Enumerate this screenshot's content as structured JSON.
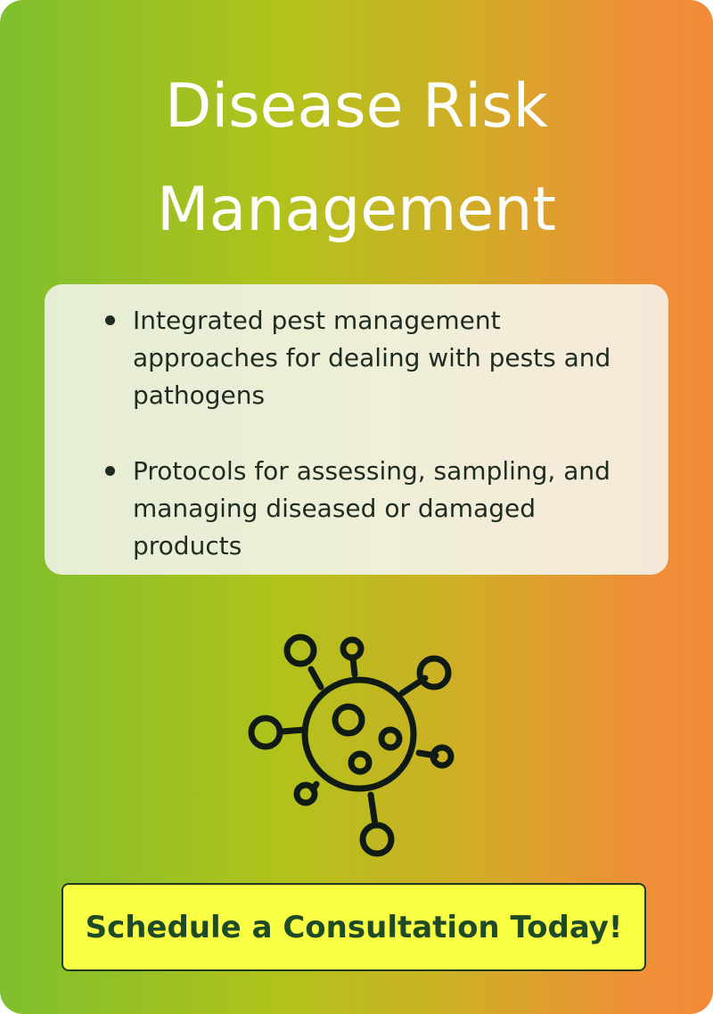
{
  "card": {
    "title_line1": "Disease Risk",
    "title_line2": "Management",
    "bullets": [
      "Integrated pest management approaches for dealing with pests and pathogens",
      "Protocols for assessing, sampling, and managing diseased or damaged products"
    ],
    "icon": "virus-icon",
    "cta_label": "Schedule a Consultation Today!"
  },
  "colors": {
    "gradient_start": "#7fbf2e",
    "gradient_end": "#f28a38",
    "title_text": "#ffffff",
    "body_text": "#1d2b20",
    "cta_background": "#fbff44",
    "cta_text": "#1f4a26"
  }
}
